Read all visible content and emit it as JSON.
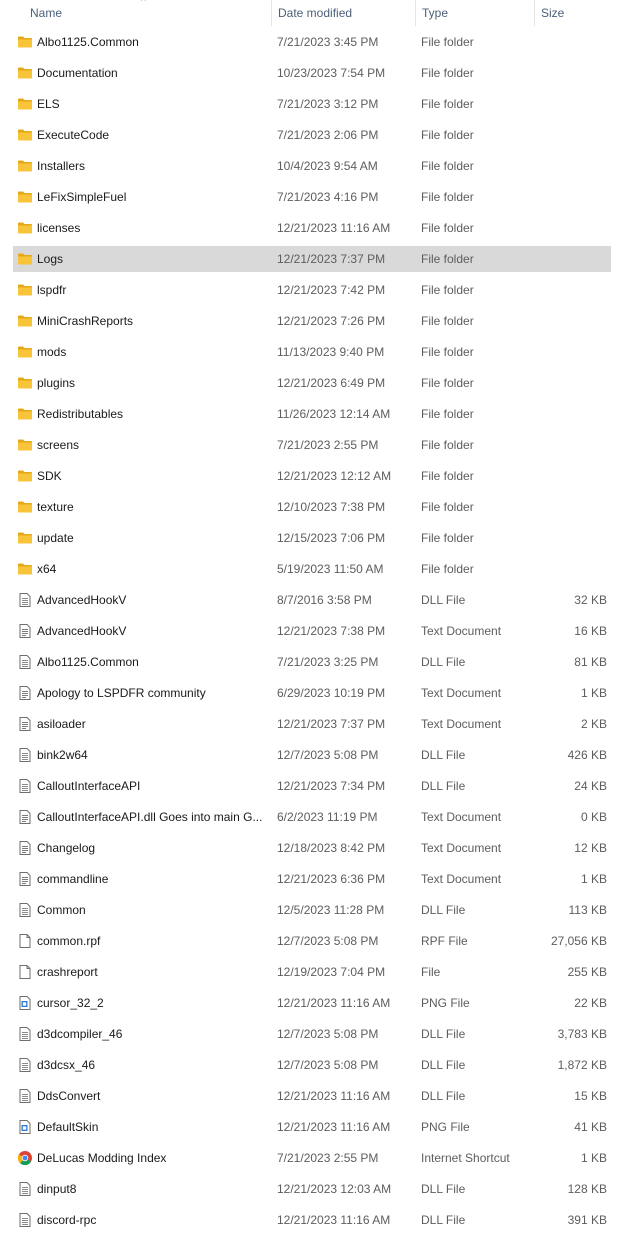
{
  "header": {
    "name": "Name",
    "date_modified": "Date modified",
    "type": "Type",
    "size": "Size",
    "sort_indicator": "^"
  },
  "files": [
    {
      "name": "Albo1125.Common",
      "date": "7/21/2023 3:45 PM",
      "type": "File folder",
      "size": "",
      "icon": "folder-icon"
    },
    {
      "name": "Documentation",
      "date": "10/23/2023 7:54 PM",
      "type": "File folder",
      "size": "",
      "icon": "folder-icon"
    },
    {
      "name": "ELS",
      "date": "7/21/2023 3:12 PM",
      "type": "File folder",
      "size": "",
      "icon": "folder-icon"
    },
    {
      "name": "ExecuteCode",
      "date": "7/21/2023 2:06 PM",
      "type": "File folder",
      "size": "",
      "icon": "folder-icon"
    },
    {
      "name": "Installers",
      "date": "10/4/2023 9:54 AM",
      "type": "File folder",
      "size": "",
      "icon": "folder-icon"
    },
    {
      "name": "LeFixSimpleFuel",
      "date": "7/21/2023 4:16 PM",
      "type": "File folder",
      "size": "",
      "icon": "folder-icon"
    },
    {
      "name": "licenses",
      "date": "12/21/2023 11:16 AM",
      "type": "File folder",
      "size": "",
      "icon": "folder-icon"
    },
    {
      "name": "Logs",
      "date": "12/21/2023 7:37 PM",
      "type": "File folder",
      "size": "",
      "icon": "folder-icon",
      "selected": true
    },
    {
      "name": "lspdfr",
      "date": "12/21/2023 7:42 PM",
      "type": "File folder",
      "size": "",
      "icon": "folder-icon"
    },
    {
      "name": "MiniCrashReports",
      "date": "12/21/2023 7:26 PM",
      "type": "File folder",
      "size": "",
      "icon": "folder-icon"
    },
    {
      "name": "mods",
      "date": "11/13/2023 9:40 PM",
      "type": "File folder",
      "size": "",
      "icon": "folder-icon"
    },
    {
      "name": "plugins",
      "date": "12/21/2023 6:49 PM",
      "type": "File folder",
      "size": "",
      "icon": "folder-icon"
    },
    {
      "name": "Redistributables",
      "date": "11/26/2023 12:14 AM",
      "type": "File folder",
      "size": "",
      "icon": "folder-icon"
    },
    {
      "name": "screens",
      "date": "7/21/2023 2:55 PM",
      "type": "File folder",
      "size": "",
      "icon": "folder-icon"
    },
    {
      "name": "SDK",
      "date": "12/21/2023 12:12 AM",
      "type": "File folder",
      "size": "",
      "icon": "folder-icon"
    },
    {
      "name": "texture",
      "date": "12/10/2023 7:38 PM",
      "type": "File folder",
      "size": "",
      "icon": "folder-icon"
    },
    {
      "name": "update",
      "date": "12/15/2023 7:06 PM",
      "type": "File folder",
      "size": "",
      "icon": "folder-icon"
    },
    {
      "name": "x64",
      "date": "5/19/2023 11:50 AM",
      "type": "File folder",
      "size": "",
      "icon": "folder-icon"
    },
    {
      "name": "AdvancedHookV",
      "date": "8/7/2016 3:58 PM",
      "type": "DLL File",
      "size": "32 KB",
      "icon": "dll-file-icon"
    },
    {
      "name": "AdvancedHookV",
      "date": "12/21/2023 7:38 PM",
      "type": "Text Document",
      "size": "16 KB",
      "icon": "text-file-icon"
    },
    {
      "name": "Albo1125.Common",
      "date": "7/21/2023 3:25 PM",
      "type": "DLL File",
      "size": "81 KB",
      "icon": "dll-file-icon"
    },
    {
      "name": "Apology to LSPDFR community",
      "date": "6/29/2023 10:19 PM",
      "type": "Text Document",
      "size": "1 KB",
      "icon": "text-file-icon"
    },
    {
      "name": "asiloader",
      "date": "12/21/2023 7:37 PM",
      "type": "Text Document",
      "size": "2 KB",
      "icon": "text-file-icon"
    },
    {
      "name": "bink2w64",
      "date": "12/7/2023 5:08 PM",
      "type": "DLL File",
      "size": "426 KB",
      "icon": "dll-file-icon"
    },
    {
      "name": "CalloutInterfaceAPI",
      "date": "12/21/2023 7:34 PM",
      "type": "DLL File",
      "size": "24 KB",
      "icon": "dll-file-icon"
    },
    {
      "name": "CalloutInterfaceAPI.dll Goes into main G...",
      "date": "6/2/2023 11:19 PM",
      "type": "Text Document",
      "size": "0 KB",
      "icon": "text-file-icon"
    },
    {
      "name": "Changelog",
      "date": "12/18/2023 8:42 PM",
      "type": "Text Document",
      "size": "12 KB",
      "icon": "text-file-icon"
    },
    {
      "name": "commandline",
      "date": "12/21/2023 6:36 PM",
      "type": "Text Document",
      "size": "1 KB",
      "icon": "text-file-icon"
    },
    {
      "name": "Common",
      "date": "12/5/2023 11:28 PM",
      "type": "DLL File",
      "size": "113 KB",
      "icon": "dll-file-icon"
    },
    {
      "name": "common.rpf",
      "date": "12/7/2023 5:08 PM",
      "type": "RPF File",
      "size": "27,056 KB",
      "icon": "blank-file-icon"
    },
    {
      "name": "crashreport",
      "date": "12/19/2023 7:04 PM",
      "type": "File",
      "size": "255 KB",
      "icon": "blank-file-icon"
    },
    {
      "name": "cursor_32_2",
      "date": "12/21/2023 11:16 AM",
      "type": "PNG File",
      "size": "22 KB",
      "icon": "png-file-icon"
    },
    {
      "name": "d3dcompiler_46",
      "date": "12/7/2023 5:08 PM",
      "type": "DLL File",
      "size": "3,783 KB",
      "icon": "dll-file-icon"
    },
    {
      "name": "d3dcsx_46",
      "date": "12/7/2023 5:08 PM",
      "type": "DLL File",
      "size": "1,872 KB",
      "icon": "dll-file-icon"
    },
    {
      "name": "DdsConvert",
      "date": "12/21/2023 11:16 AM",
      "type": "DLL File",
      "size": "15 KB",
      "icon": "dll-file-icon"
    },
    {
      "name": "DefaultSkin",
      "date": "12/21/2023 11:16 AM",
      "type": "PNG File",
      "size": "41 KB",
      "icon": "png-file-icon"
    },
    {
      "name": "DeLucas Modding Index",
      "date": "7/21/2023 2:55 PM",
      "type": "Internet Shortcut",
      "size": "1 KB",
      "icon": "chrome-shortcut-icon"
    },
    {
      "name": "dinput8",
      "date": "12/21/2023 12:03 AM",
      "type": "DLL File",
      "size": "128 KB",
      "icon": "dll-file-icon"
    },
    {
      "name": "discord-rpc",
      "date": "12/21/2023 11:16 AM",
      "type": "DLL File",
      "size": "391 KB",
      "icon": "dll-file-icon"
    }
  ],
  "colors": {
    "folder": "#f8c43a",
    "folder_dark": "#e5a918",
    "selected_row": "#d9d9d9",
    "header_text": "#4c607a",
    "secondary_text": "#5d5d5d"
  }
}
